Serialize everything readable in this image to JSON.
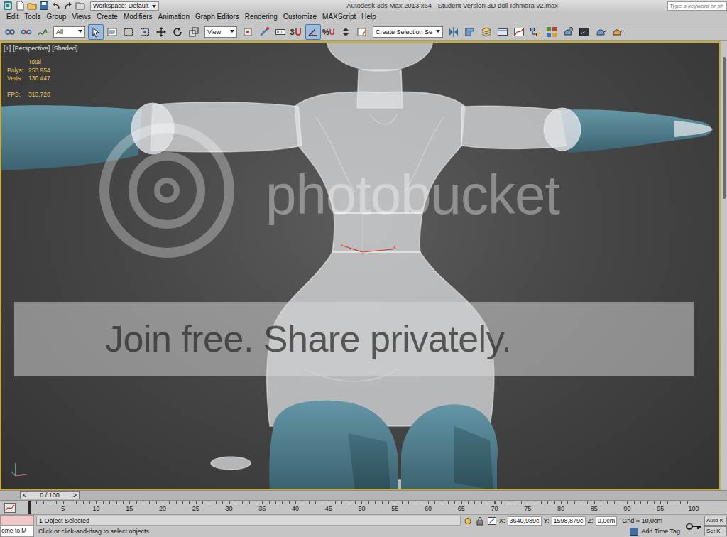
{
  "window": {
    "title": "Autodesk 3ds Max 2013 x64 - Student Version 3D doll Ichmara v2.max",
    "workspace": "Workspace: Default"
  },
  "search": {
    "placeholder": "Type a keyword or ph"
  },
  "menu": [
    "Edit",
    "Tools",
    "Group",
    "Views",
    "Create",
    "Modifiers",
    "Animation",
    "Graph Editors",
    "Rendering",
    "Customize",
    "MAXScript",
    "Help"
  ],
  "toolbar": {
    "selection_filter": "All",
    "reference_coord": "View",
    "named_selection": "Create Selection Se",
    "buttons": [
      {
        "selected": false
      },
      {
        "selected": false
      },
      {
        "selected": false
      },
      {
        "selected": true
      },
      {
        "selected": false
      },
      {
        "selected": false
      },
      {
        "selected": false
      },
      {
        "selected": false
      },
      {
        "selected": false
      },
      {
        "selected": false
      },
      {
        "selected": false
      },
      {
        "selected": false
      },
      {
        "selected": false
      },
      {
        "selected": false,
        "label": "3"
      },
      {
        "selected": true
      },
      {
        "selected": false,
        "label": "%"
      },
      {
        "selected": false
      },
      {
        "selected": false
      },
      {
        "selected": false
      },
      {
        "selected": false
      },
      {
        "selected": false
      },
      {
        "selected": false
      },
      {
        "selected": false
      },
      {
        "selected": false
      },
      {
        "selected": false
      },
      {
        "selected": false
      },
      {
        "selected": false
      },
      {
        "selected": false
      },
      {
        "selected": false
      }
    ]
  },
  "viewport": {
    "labels": [
      "[+]",
      "[Perspective]",
      "[Shaded]"
    ],
    "stats": {
      "header": "Total",
      "rows": [
        {
          "label": "Polys:",
          "value": "253.954"
        },
        {
          "label": "Verts:",
          "value": "130.447"
        }
      ],
      "fps_label": "FPS:",
      "fps_value": "313,720"
    },
    "gizmo": {
      "z": "z",
      "x": "x"
    }
  },
  "watermark": {
    "brand": "photobucket",
    "banner": "Join free. Share privately."
  },
  "time_slider": {
    "prev": "<",
    "label": "0 / 100",
    "next": ">",
    "level": 0
  },
  "track_bar": {
    "ticks": [
      "5",
      "10",
      "15",
      "20",
      "25",
      "30",
      "35",
      "40",
      "45",
      "50",
      "55",
      "60",
      "65",
      "70",
      "75",
      "80",
      "85",
      "90",
      "95",
      "100"
    ]
  },
  "status_bar": {
    "listener": "ome to M",
    "selection": "1 Object Selected",
    "prompt": "Click or click-and-drag to select objects",
    "coords": [
      {
        "label": "X:",
        "value": "3640,989c"
      },
      {
        "label": "Y:",
        "value": "1598,879c"
      },
      {
        "label": "Z:",
        "value": "0,0cm"
      }
    ],
    "grid": "Grid = 10,0cm",
    "auto_key": "Auto K",
    "set_key": "Set K",
    "add_time_tag": "Add Time Tag"
  }
}
